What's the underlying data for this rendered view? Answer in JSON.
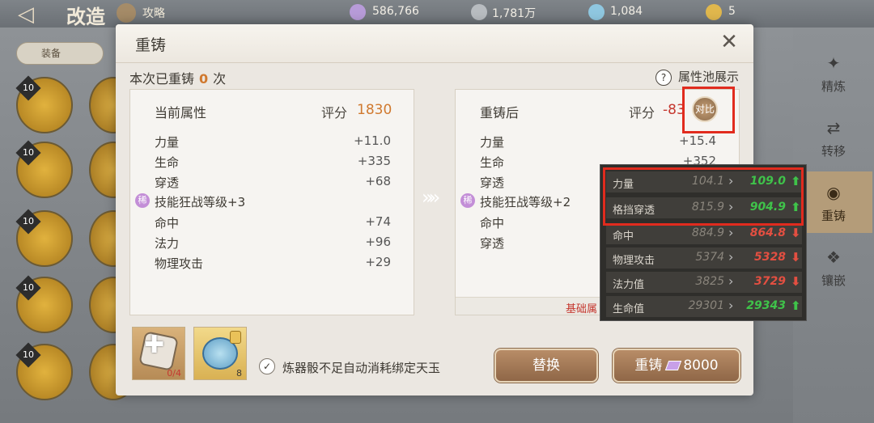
{
  "topbar": {
    "back": "◁",
    "title": "改造",
    "guide": "攻略",
    "resources": [
      "586,766",
      "1,781万",
      "1,084",
      "5"
    ]
  },
  "filter": {
    "label": "装备"
  },
  "slots": [
    "10",
    "10",
    "10",
    "10",
    "10"
  ],
  "side_tabs": [
    {
      "icon": "✦",
      "label": "精炼"
    },
    {
      "icon": "⇄",
      "label": "转移"
    },
    {
      "icon": "◉",
      "label": "重铸"
    },
    {
      "icon": "❖",
      "label": "镶嵌"
    }
  ],
  "dialog": {
    "title": "重铸",
    "close": "✕",
    "count_prefix": "本次已重铸",
    "count_value": "0",
    "count_suffix": "次",
    "pool_help": "?",
    "pool_label": "属性池展示",
    "compare_label": "对比"
  },
  "current": {
    "heading": "当前属性",
    "score_label": "评分",
    "score": "1830",
    "stats": [
      {
        "name": "力量",
        "value": "+11.0"
      },
      {
        "name": "生命",
        "value": "+335"
      },
      {
        "name": "穿透",
        "value": "+68"
      },
      {
        "name": "技能狂战等级+3",
        "value": "",
        "skill": true
      },
      {
        "name": "命中",
        "value": "+74"
      },
      {
        "name": "法力",
        "value": "+96"
      },
      {
        "name": "物理攻击",
        "value": "+29"
      }
    ]
  },
  "after": {
    "heading": "重铸后",
    "score_label": "评分",
    "score": "-83",
    "stats": [
      {
        "name": "力量",
        "value": "+15.4"
      },
      {
        "name": "生命",
        "value": "+352"
      },
      {
        "name": "穿透",
        "value": ""
      },
      {
        "name": "技能狂战等级+2",
        "value": "",
        "skill": true
      },
      {
        "name": "命中",
        "value": ""
      },
      {
        "name": "穿透",
        "value": ""
      }
    ],
    "footer": "基础属"
  },
  "skill_badge": "稀",
  "items": {
    "dice_count": "0/4",
    "jade_count": "8"
  },
  "auto": {
    "check": "✓",
    "label": "炼器骰不足自动消耗绑定天玉"
  },
  "buttons": {
    "replace": "替换",
    "reforge": "重铸",
    "reforge_cost": "8000"
  },
  "comparison": [
    {
      "name": "力量",
      "old": "104.1",
      "new": "109.0",
      "dir": "up"
    },
    {
      "name": "格挡穿透",
      "old": "815.9",
      "new": "904.9",
      "dir": "up"
    },
    {
      "name": "命中",
      "old": "884.9",
      "new": "864.8",
      "dir": "down"
    },
    {
      "name": "物理攻击",
      "old": "5374",
      "new": "5328",
      "dir": "down"
    },
    {
      "name": "法力值",
      "old": "3825",
      "new": "3729",
      "dir": "down"
    },
    {
      "name": "生命值",
      "old": "29301",
      "new": "29343",
      "dir": "up"
    }
  ],
  "colors": {
    "accent": "#d0792f",
    "negative": "#c5372f",
    "up": "#3fc34a",
    "down": "#e34f41",
    "highlight": "#e12b1e"
  }
}
